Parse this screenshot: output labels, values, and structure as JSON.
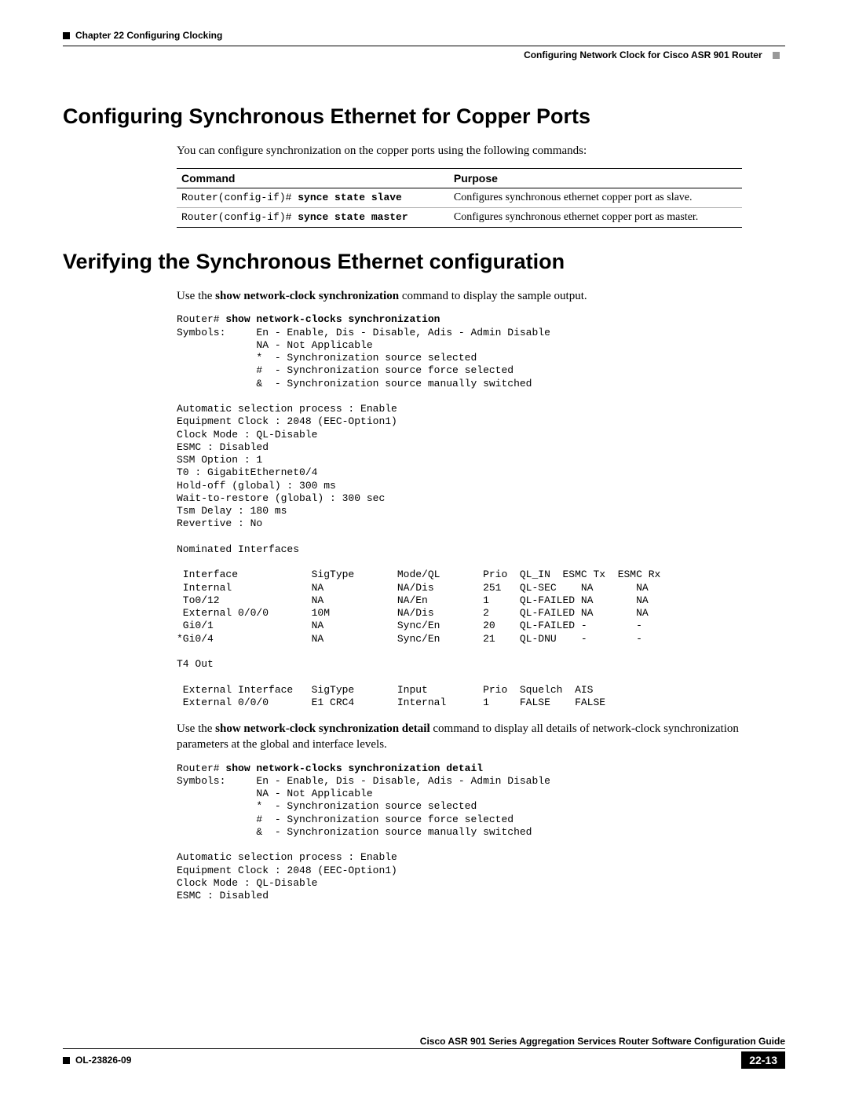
{
  "header": {
    "chapter": "Chapter 22    Configuring Clocking",
    "section": "Configuring Network Clock for Cisco ASR 901 Router"
  },
  "h1a": "Configuring Synchronous Ethernet for Copper Ports",
  "p1": "You can configure synchronization on the copper ports using the following commands:",
  "table": {
    "hCommand": "Command",
    "hPurpose": "Purpose",
    "r1prefix": "Router(config-if)# ",
    "r1cmd": "synce state slave",
    "r1purpose": "Configures synchronous ethernet copper port as slave.",
    "r2prefix": "Router(config-if)# ",
    "r2cmd": "synce state master",
    "r2purpose": "Configures synchronous ethernet copper port as master."
  },
  "h1b": "Verifying the Synchronous Ethernet configuration",
  "p2pre": "Use the ",
  "p2bold": "show network-clock synchronization",
  "p2post": " command to display the sample output.",
  "block1_prefix": "Router# ",
  "block1_cmd": "show network-clocks synchronization",
  "block1_body": "Symbols:     En - Enable, Dis - Disable, Adis - Admin Disable\n             NA - Not Applicable\n             *  - Synchronization source selected\n             #  - Synchronization source force selected\n             &  - Synchronization source manually switched\n\nAutomatic selection process : Enable\nEquipment Clock : 2048 (EEC-Option1)\nClock Mode : QL-Disable\nESMC : Disabled\nSSM Option : 1\nT0 : GigabitEthernet0/4\nHold-off (global) : 300 ms\nWait-to-restore (global) : 300 sec\nTsm Delay : 180 ms\nRevertive : No\n\nNominated Interfaces\n\n Interface            SigType       Mode/QL       Prio  QL_IN  ESMC Tx  ESMC Rx\n Internal             NA            NA/Dis        251   QL-SEC    NA       NA\n To0/12               NA            NA/En         1     QL-FAILED NA       NA\n External 0/0/0       10M           NA/Dis        2     QL-FAILED NA       NA\n Gi0/1                NA            Sync/En       20    QL-FAILED -        -\n*Gi0/4                NA            Sync/En       21    QL-DNU    -        -\n\nT4 Out\n\n External Interface   SigType       Input         Prio  Squelch  AIS\n External 0/0/0       E1 CRC4       Internal      1     FALSE    FALSE",
  "p3pre": "Use the ",
  "p3bold": "show network-clock synchronization detail",
  "p3post": " command to display all details of network-clock synchronization parameters at the global and interface levels.",
  "block2_prefix": "Router# ",
  "block2_cmd": "show network-clocks synchronization detail",
  "block2_body": "Symbols:     En - Enable, Dis - Disable, Adis - Admin Disable\n             NA - Not Applicable\n             *  - Synchronization source selected\n             #  - Synchronization source force selected\n             &  - Synchronization source manually switched\n\nAutomatic selection process : Enable\nEquipment Clock : 2048 (EEC-Option1)\nClock Mode : QL-Disable\nESMC : Disabled",
  "footer": {
    "guide": "Cisco ASR 901 Series Aggregation Services Router Software Configuration Guide",
    "docnum": "OL-23826-09",
    "pagenum": "22-13"
  }
}
